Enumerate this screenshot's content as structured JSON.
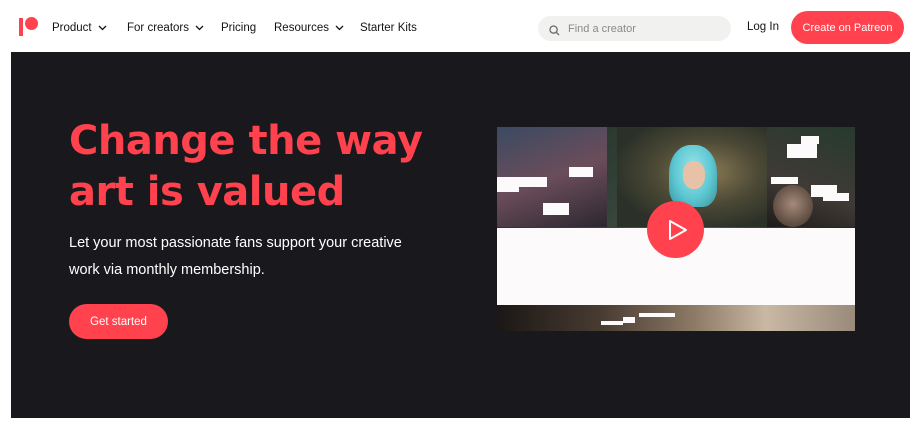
{
  "nav": {
    "items": [
      {
        "label": "Product",
        "has_dropdown": true
      },
      {
        "label": "For creators",
        "has_dropdown": true
      },
      {
        "label": "Pricing",
        "has_dropdown": false
      },
      {
        "label": "Resources",
        "has_dropdown": true
      },
      {
        "label": "Starter Kits",
        "has_dropdown": false
      }
    ],
    "search": {
      "placeholder": "Find a creator",
      "value": "",
      "icon": "search-icon"
    },
    "login_label": "Log In",
    "create_label": "Create on Patreon",
    "logo_icon": "patreon-logo"
  },
  "hero": {
    "headline_lines": [
      "Change the way",
      "art is valued"
    ],
    "subtext_lines": [
      "Let your most passionate fans support your creative",
      "work via monthly membership."
    ],
    "cta_label": "Get started",
    "video": {
      "play_icon": "play-icon"
    }
  },
  "colors": {
    "brand": "#ff424d",
    "hero_background": "#19181c",
    "nav_background": "#ffffff",
    "text_dark": "#141414",
    "search_background": "#f1f1f0"
  }
}
